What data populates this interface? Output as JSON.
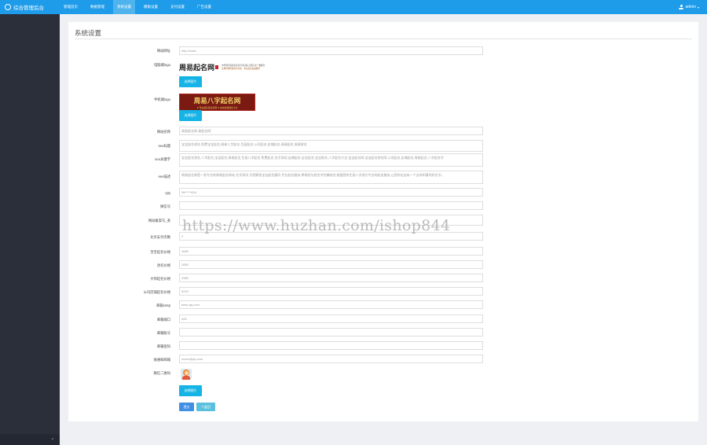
{
  "app": {
    "title": "综合管理后台"
  },
  "nav": [
    {
      "label": "管理首页",
      "active": false
    },
    {
      "label": "数据管理",
      "active": false
    },
    {
      "label": "系统设置",
      "active": true
    },
    {
      "label": "模板设置",
      "active": false
    },
    {
      "label": "支付设置",
      "active": false
    },
    {
      "label": "广告设置",
      "active": false
    }
  ],
  "user": {
    "name": "admin"
  },
  "sidebar": {
    "toggle": "‹"
  },
  "page": {
    "title": "系统设置"
  },
  "form": {
    "site_url": {
      "label": "网站网址",
      "placeholder": "http://www"
    },
    "pc_logo": {
      "label": "电脑端logo",
      "button": "选择图片",
      "image": {
        "main": "周易起名网",
        "line1": "中华国学资源宝库易学专业站,全国万家一致推荐",
        "line2": "弘扬中国传统易学文化 · 专业起名权威服务"
      }
    },
    "mobile_logo": {
      "label": "手机端logo",
      "button": "选择图片",
      "image": {
        "main": "周易八字起名网",
        "sub": "★ 专业起名改名名网 ★ 在线免费起名大全"
      }
    },
    "site_name": {
      "label": "网站名称",
      "value": "周易起名网-易起名网"
    },
    "seo_title": {
      "label": "seo标题",
      "value": "宝宝起名测名,免费宝宝起名,周易八字起名,生辰起名,公司起名,店铺起名,周易起名,周易取名"
    },
    "seo_keywords": {
      "label": "seo关键字",
      "value": "宝宝起名测名,八字起名,宝宝起名,周易起名,生辰八字起名,免费起名,名字测试,店铺起名,宝宝起名,宝宝取名,八字起名大全,宝宝起名网,宝宝起名测名网,公司起名,店铺起名,周易起名,八字起名字"
    },
    "seo_description": {
      "label": "seo描述",
      "value": "周易起名网是一家专业的周易起名网站,名字测试,为您解答宝宝起名疑问,专业起名服务,将易经与姓名学完美结合,根据您的生辰八字进行专业的起名服务,让您的宝宝有一个吉祥如意的好名字。"
    },
    "qq": {
      "label": "QQ",
      "value": "96*****818"
    },
    "wechat": {
      "label": "微信号",
      "value": ""
    },
    "icp": {
      "label": "网站备案号_查",
      "value": ""
    },
    "pay_counter": {
      "label": "允许支付次数",
      "value": "2"
    },
    "price_baby": {
      "label": "宝宝起名价格",
      "value": "1680"
    },
    "price_rename": {
      "label": "改名价格",
      "value": "2850"
    },
    "price_master": {
      "label": "大师起名价格",
      "value": "4380"
    },
    "price_company": {
      "label": "公司店铺起名价格",
      "value": "5220"
    },
    "smtp": {
      "label": "邮箱smtp",
      "value": "smtp.qq.com"
    },
    "port": {
      "label": "邮箱端口",
      "value": "465"
    },
    "account": {
      "label": "邮箱账号",
      "value": ""
    },
    "password": {
      "label": "邮箱密码",
      "value": ""
    },
    "notify_email": {
      "label": "收通知邮箱",
      "value": "xxxxx@qq.com"
    },
    "qrcode": {
      "label": "微信二维码",
      "button": "选择图片"
    },
    "submit": "提交",
    "back": "返回"
  },
  "watermark": "https://www.huzhan.com/ishop844",
  "colors": {
    "topbar": "#1e9be9",
    "sidebar": "#2a2f3a",
    "upload": "#16b4e6",
    "submit": "#3f8fe3",
    "back": "#5bc0de"
  }
}
